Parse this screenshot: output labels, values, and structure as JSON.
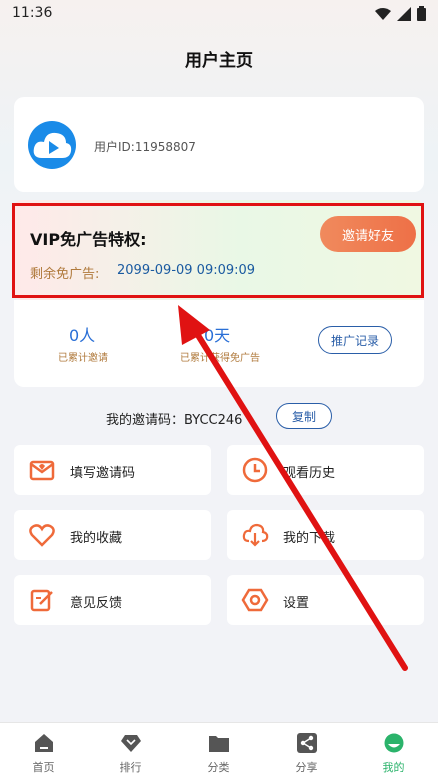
{
  "status_bar": {
    "time": "11:36"
  },
  "header": {
    "title": "用户主页"
  },
  "profile": {
    "user_id": "用户ID:11958807"
  },
  "vip": {
    "title": "VIP免广告特权:",
    "remaining_label": "剩余免广告:",
    "remaining_value": "2099-09-09 09:09:09",
    "invite_button": "邀请好友"
  },
  "stats": [
    {
      "value": "0人",
      "label": "已累计邀请"
    },
    {
      "value": "0天",
      "label": "已累计获得免广告"
    }
  ],
  "promo_button": "推广记录",
  "invite_code": {
    "label": "我的邀请码：BYCC246",
    "copy_button": "复制"
  },
  "menu": [
    {
      "label": "填写邀请码",
      "icon": "envelope-icon"
    },
    {
      "label": "观看历史",
      "icon": "clock-icon"
    },
    {
      "label": "我的收藏",
      "icon": "heart-icon"
    },
    {
      "label": "我的下载",
      "icon": "cloud-download-icon"
    },
    {
      "label": "意见反馈",
      "icon": "edit-icon"
    },
    {
      "label": "设置",
      "icon": "gear-icon"
    }
  ],
  "bottom_nav": [
    {
      "label": "首页",
      "icon": "home-icon"
    },
    {
      "label": "排行",
      "icon": "ranking-icon"
    },
    {
      "label": "分类",
      "icon": "folder-icon"
    },
    {
      "label": "分享",
      "icon": "share-icon"
    },
    {
      "label": "我的",
      "icon": "profile-icon",
      "active": true
    }
  ],
  "colors": {
    "accent": "#2bb36b",
    "highlight_border": "#e01212",
    "button_orange": "#ee7047",
    "link_blue": "#2a5ea8"
  }
}
